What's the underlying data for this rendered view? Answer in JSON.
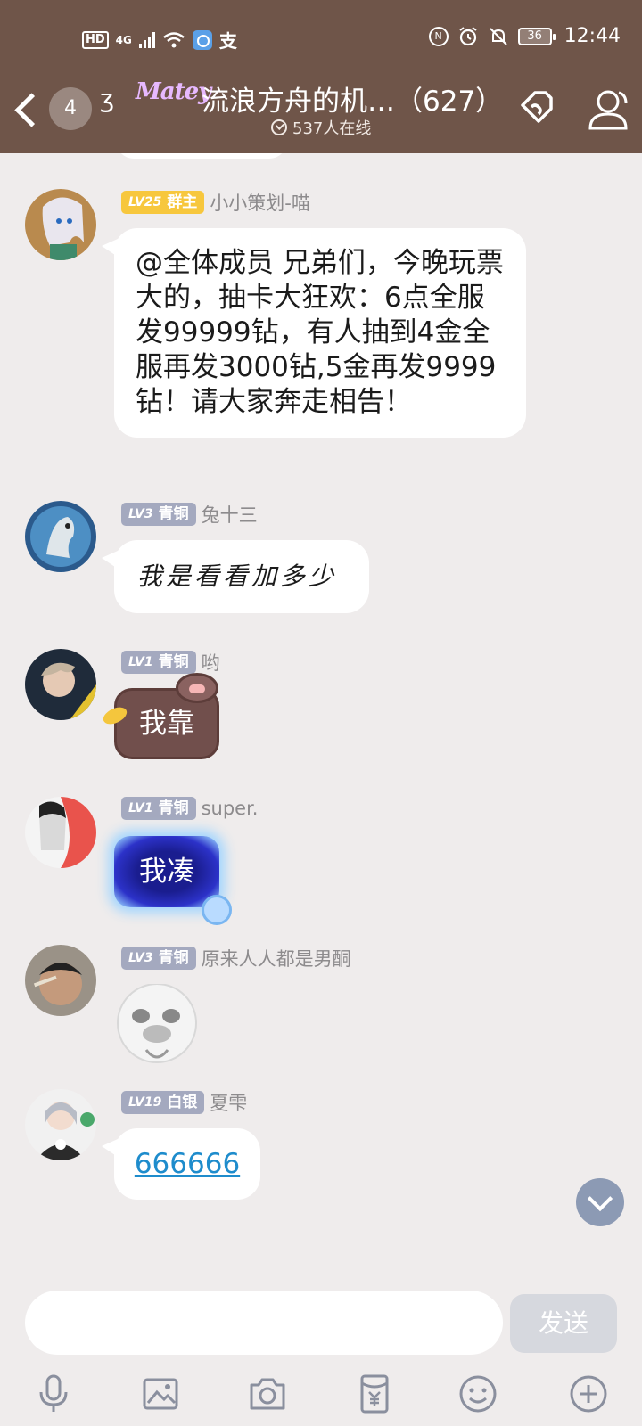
{
  "status_bar": {
    "hd": "HD",
    "network": "4G",
    "zhi_glyph": "支",
    "battery": "36",
    "time": "12:44"
  },
  "header": {
    "unread_count": "4",
    "logo_text": "Matey",
    "title": "流浪方舟的机…（627）",
    "online": "537人在线"
  },
  "messages": [
    {
      "level": "LV25",
      "role": "群主",
      "name": "小小策划-喵",
      "text": "@全体成员 兄弟们，今晚玩票大的，抽卡大狂欢：6点全服发99999钻，有人抽到4金全服再发3000钻,5金再发9999钻！请大家奔走相告！"
    },
    {
      "level": "LV3",
      "role": "青铜",
      "name": "兔十三",
      "text": "我是看看加多少"
    },
    {
      "level": "LV1",
      "role": "青铜",
      "name": "哟",
      "text": "我靠"
    },
    {
      "level": "LV1",
      "role": "青铜",
      "name": "super.",
      "text": "我凑"
    },
    {
      "level": "LV3",
      "role": "青铜",
      "name": "原来人人都是男酮",
      "sticker": "panda-meme-sticker"
    },
    {
      "level": "LV19",
      "role": "白银",
      "name": "夏雫",
      "text": "666666"
    }
  ],
  "input": {
    "placeholder": "",
    "send_label": "发送"
  },
  "toolbar_icons": [
    "microphone-icon",
    "image-icon",
    "camera-icon",
    "red-packet-icon",
    "emoji-icon",
    "plus-icon"
  ],
  "colors": {
    "header_bg": "#6f5549",
    "chat_bg": "#efecec",
    "owner_badge": "#f7c73d",
    "member_badge": "#a4a9bf",
    "link": "#1e8ccc",
    "send_disabled": "#d6d8de"
  }
}
